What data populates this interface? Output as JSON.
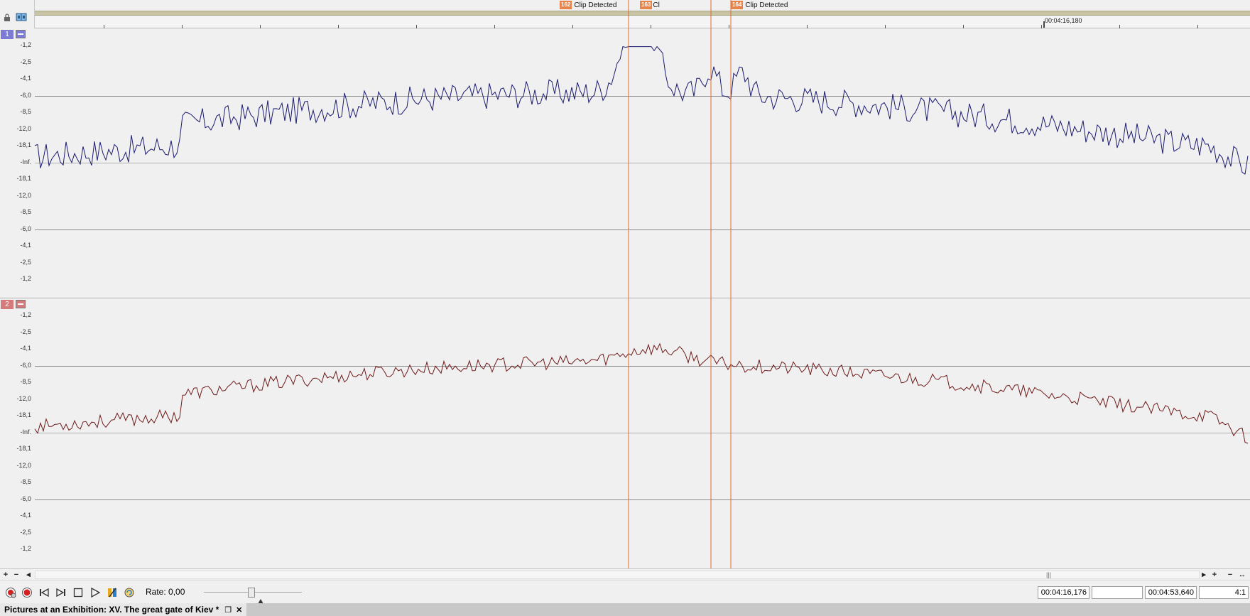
{
  "markers": [
    {
      "num": "162",
      "label": "Clip Detected"
    },
    {
      "num": "163",
      "label": "Cl"
    },
    {
      "num": "164",
      "label": "Clip Detected"
    }
  ],
  "ruler": {
    "cursor_time": "00:04:16,180"
  },
  "channels": [
    {
      "num": "1",
      "color": "#7b7bd6",
      "wave_color": "#1a1a6e"
    },
    {
      "num": "2",
      "color": "#d67b7b",
      "wave_color": "#6e1a1a"
    }
  ],
  "db_labels": [
    "-1,2",
    "-2,5",
    "-4,1",
    "-6,0",
    "-8,5",
    "-12,0",
    "-18,1",
    "-Inf.",
    "-18,1",
    "-12,0",
    "-8,5",
    "-6,0",
    "-4,1",
    "-2,5",
    "-1,2"
  ],
  "transport": {
    "rate_label": "Rate: 0,00",
    "selection_start": "00:04:16,176",
    "selection_end": "",
    "selection_length": "00:04:53,640",
    "zoom": "4:1"
  },
  "document": {
    "title": "Pictures at an Exhibition: XV. The great gate of Kiev *"
  },
  "icons": {
    "lock": "lock-icon",
    "channel_toggle": "channel-toggle-icon"
  },
  "colors": {
    "marker": "#e8834a",
    "marker_line": "#e06a2a"
  }
}
